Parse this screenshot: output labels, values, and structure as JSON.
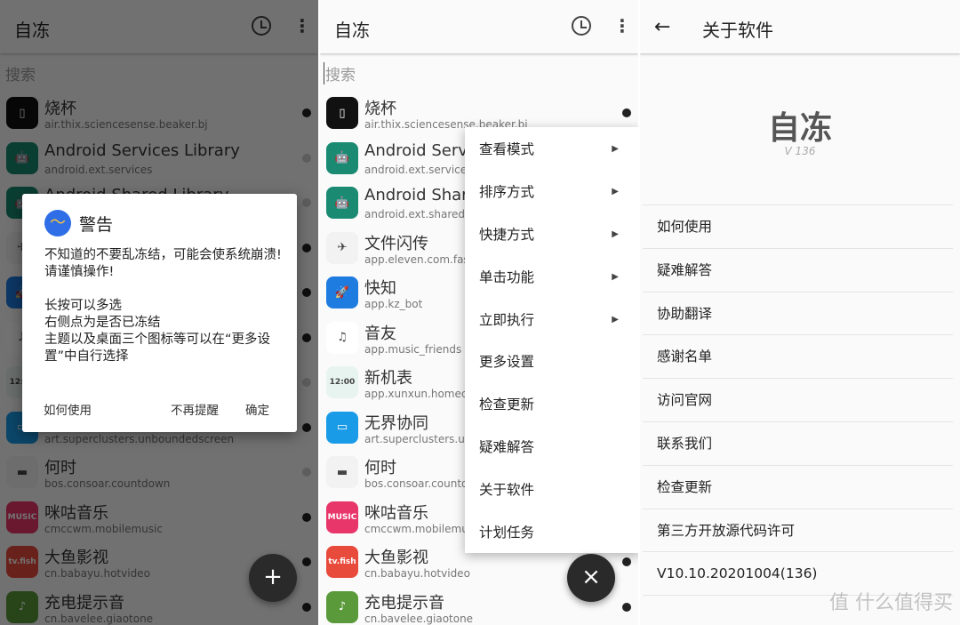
{
  "app": {
    "title": "自冻",
    "search_placeholder": "搜索",
    "more_icon": "⋮"
  },
  "apps": [
    {
      "name": "烧杯",
      "package": "air.thix.sciencesense.beaker.bj",
      "icon_color": "#111111",
      "glyph": "▯",
      "frozen": true
    },
    {
      "name": "Android Services Library",
      "package": "android.ext.services",
      "icon_color": "#1a8a72",
      "glyph": "🤖",
      "frozen": false
    },
    {
      "name": "Android Shared Library",
      "package": "android.ext.shared",
      "icon_color": "#1a8a72",
      "glyph": "🤖",
      "frozen": false
    },
    {
      "name": "文件闪传",
      "package": "app.eleven.com.fastfiletransfer",
      "icon_color": "#f2f2f2",
      "glyph": "✈",
      "frozen": true
    },
    {
      "name": "快知",
      "package": "app.kz_bot",
      "icon_color": "#1e7be0",
      "glyph": "🚀",
      "frozen": true
    },
    {
      "name": "音友",
      "package": "app.music_friends",
      "icon_color": "#ffffff",
      "glyph": "♫",
      "frozen": true
    },
    {
      "name": "新机表",
      "package": "app.xunxun.homeclock",
      "icon_color": "#e8f4f0",
      "glyph": "12:00",
      "frozen": false
    },
    {
      "name": "无界协同",
      "package": "art.superclusters.unboundedscreen",
      "icon_color": "#1a9be8",
      "glyph": "▭",
      "frozen": true
    },
    {
      "name": "何时",
      "package": "bos.consoar.countdown",
      "icon_color": "#f2f2f2",
      "glyph": "▬",
      "frozen": false
    },
    {
      "name": "咪咕音乐",
      "package": "cmccwm.mobilemusic",
      "icon_color": "#e8356a",
      "glyph": "MUSIC",
      "frozen": true
    },
    {
      "name": "大鱼影视",
      "package": "cn.babayu.hotvideo",
      "icon_color": "#e84a3c",
      "glyph": "tv.fish",
      "frozen": true
    },
    {
      "name": "充电提示音",
      "package": "cn.bavelee.giaotone",
      "icon_color": "#5a9a3a",
      "glyph": "♪",
      "frozen": true
    }
  ],
  "dialog": {
    "title": "警告",
    "body": "不知道的不要乱冻结，可能会使系统崩溃!\n请谨慎操作!\n\n长按可以多选\n右侧点为是否已冻结\n主题以及桌面三个图标等可以在“更多设置”中自行选择",
    "buttons": {
      "how": "如何使用",
      "dont_remind": "不再提醒",
      "ok": "确定"
    }
  },
  "fab": {
    "add": "+",
    "close": "×"
  },
  "menu": [
    {
      "label": "查看模式",
      "submenu": true
    },
    {
      "label": "排序方式",
      "submenu": true
    },
    {
      "label": "快捷方式",
      "submenu": true
    },
    {
      "label": "单击功能",
      "submenu": true
    },
    {
      "label": "立即执行",
      "submenu": true
    },
    {
      "label": "更多设置",
      "submenu": false
    },
    {
      "label": "检查更新",
      "submenu": false
    },
    {
      "label": "疑难解答",
      "submenu": false
    },
    {
      "label": "关于软件",
      "submenu": false
    },
    {
      "label": "计划任务",
      "submenu": false
    }
  ],
  "about": {
    "header": "关于软件",
    "app_name": "自冻",
    "version": "V 136",
    "items": [
      "如何使用",
      "疑难解答",
      "协助翻译",
      "感谢名单",
      "访问官网",
      "联系我们",
      "检查更新",
      "第三方开放源代码许可",
      "V10.10.20201004(136)"
    ]
  },
  "watermark": "值 什么值得买",
  "colors": {
    "frozen_dot": "#222222",
    "unfrozen_dot": "#cfcfcf",
    "fab": "#2a2a2a"
  }
}
